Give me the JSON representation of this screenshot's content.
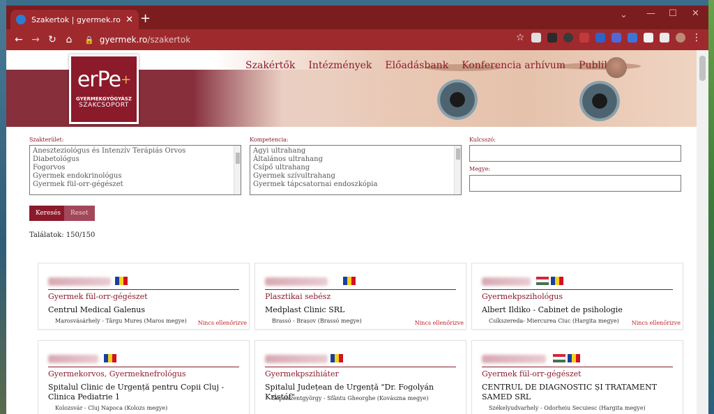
{
  "browser": {
    "tab_title": "Szakertok | gyermek.ro",
    "tab_close": "✕",
    "new_tab": "+",
    "url_host": "gyermek.ro",
    "url_path": "/szakertok",
    "back": "←",
    "forward": "→",
    "reload": "↻",
    "home": "⌂",
    "star": "☆",
    "menu": "⋮",
    "min": "—",
    "max": "☐",
    "close": "✕"
  },
  "logo": {
    "mark": "erPe",
    "plus": "+",
    "line1": "GYERMEKGYÓGYÁSZ",
    "line2": "SZAKCSOPORT"
  },
  "nav": {
    "items": [
      "Szakértők",
      "Intézmények",
      "Előadásbank",
      "Konferencia arhívum",
      "Publikus"
    ]
  },
  "filters": {
    "szakterulet_label": "Szakterület:",
    "szakterulet_options": [
      "Aneszteziológus és Intenzív Terápiás Orvos",
      "Diabetológus",
      "Fogorvos",
      "Gyermek endokrinológus",
      "Gyermek fül-orr-gégészet"
    ],
    "kompetencia_label": "Kompetencia:",
    "kompetencia_options": [
      "Agyi ultrahang",
      "Általános ultrahang",
      "Csípő ultrahang",
      "Gyermek szívultrahang",
      "Gyermek tápcsatornai endoszkópia"
    ],
    "kulcsszo_label": "Kulcsszó:",
    "megye_label": "Megye:"
  },
  "buttons": {
    "search": "Keresés",
    "reset": "Reset"
  },
  "results_text": "Találatok: 150/150",
  "cards": [
    {
      "flags": [
        "ro"
      ],
      "spec": "Gyermek fül-orr-gégészet",
      "inst": "Centrul Medical Galenus",
      "loc": "Marosvásárhely - Târgu Mureș (Maros megye)",
      "status": "Nincs ellenőrizve"
    },
    {
      "flags": [
        "ro"
      ],
      "spec": "Plasztikai sebész",
      "inst": "Medplast Clinic SRL",
      "loc": "Brassó - Brașov (Brassó megye)",
      "status": "Nincs ellenőrizve"
    },
    {
      "flags": [
        "hu",
        "ro"
      ],
      "spec": "Gyermekpszihológus",
      "inst": "Albert Ildiko - Cabinet de psihologie",
      "loc": "Csíkszereda- Miercurea Ciuc (Hargita megye)",
      "status": "Nincs ellenőrizve"
    },
    {
      "flags": [
        "ro"
      ],
      "spec": "Gyermekorvos, Gyermeknefrológus",
      "inst": "Spitalul Clinic de Urgență pentru Copii Cluj - Clinica Pediatrie 1",
      "loc": "Kolozsvár - Cluj Napoca (Kolozs megye)",
      "status": ""
    },
    {
      "flags": [
        "ro"
      ],
      "spec": "Gyermekpszihiáter",
      "inst": "Spitalul Județean de Urgență \"Dr. Fogolyán Kristóf\"",
      "loc": "Sepsiszentgyörgy - Sfântu Gheorghe (Kovászna megye)",
      "status": ""
    },
    {
      "flags": [
        "hu",
        "ro"
      ],
      "spec": "Gyermek fül-orr-gégészet",
      "inst": "CENTRUL DE DIAGNOSTIC ȘI TRATAMENT SAMED SRL",
      "loc": "Székelyudvarhely - Odorheiu Secuiesc (Hargita megye)",
      "status": ""
    }
  ],
  "colors": {
    "brand": "#8b1a2b",
    "browser_frame": "#9e2a2e",
    "status_red": "#c0202a"
  }
}
